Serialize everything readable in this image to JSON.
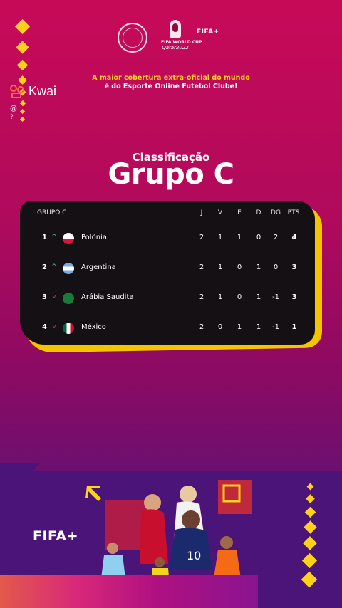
{
  "header": {
    "fifa_small": "FIFA",
    "wc_line1": "FIFA WORLD CUP",
    "wc_line2": "Qatar2022",
    "tagline_line1": "A maior cobertura extra-oficial do mundo",
    "tagline_line2": "é do Esporte Online Futebol Clube!"
  },
  "kwai": {
    "brand": "Kwai",
    "at": "@",
    "q": "?"
  },
  "title": {
    "small": "Classificação",
    "big": "Grupo C"
  },
  "table": {
    "group_label": "GRUPO C",
    "columns": [
      "J",
      "V",
      "E",
      "D",
      "DG",
      "PTS"
    ],
    "rows": [
      {
        "pos": "1",
        "trend": "up",
        "team": "Polônia",
        "flag": "poland-flag-icon",
        "J": "2",
        "V": "1",
        "E": "1",
        "D": "0",
        "DG": "2",
        "PTS": "4"
      },
      {
        "pos": "2",
        "trend": "up",
        "team": "Argentina",
        "flag": "argentina-flag-icon",
        "J": "2",
        "V": "1",
        "E": "0",
        "D": "1",
        "DG": "0",
        "PTS": "3"
      },
      {
        "pos": "3",
        "trend": "down",
        "team": "Arábia Saudita",
        "flag": "saudi-arabia-flag-icon",
        "J": "2",
        "V": "1",
        "E": "0",
        "D": "1",
        "DG": "-1",
        "PTS": "3"
      },
      {
        "pos": "4",
        "trend": "down",
        "team": "México",
        "flag": "mexico-flag-icon",
        "J": "2",
        "V": "0",
        "E": "1",
        "D": "1",
        "DG": "-1",
        "PTS": "1"
      }
    ],
    "trend_up_glyph": "^",
    "trend_down_glyph": "v"
  },
  "footer": {
    "fifa_logo": "FIFA"
  },
  "colors": {
    "accent": "#ffd21a",
    "table_bg": "#141014",
    "up": "#3dd68c",
    "down": "#e0365a"
  }
}
